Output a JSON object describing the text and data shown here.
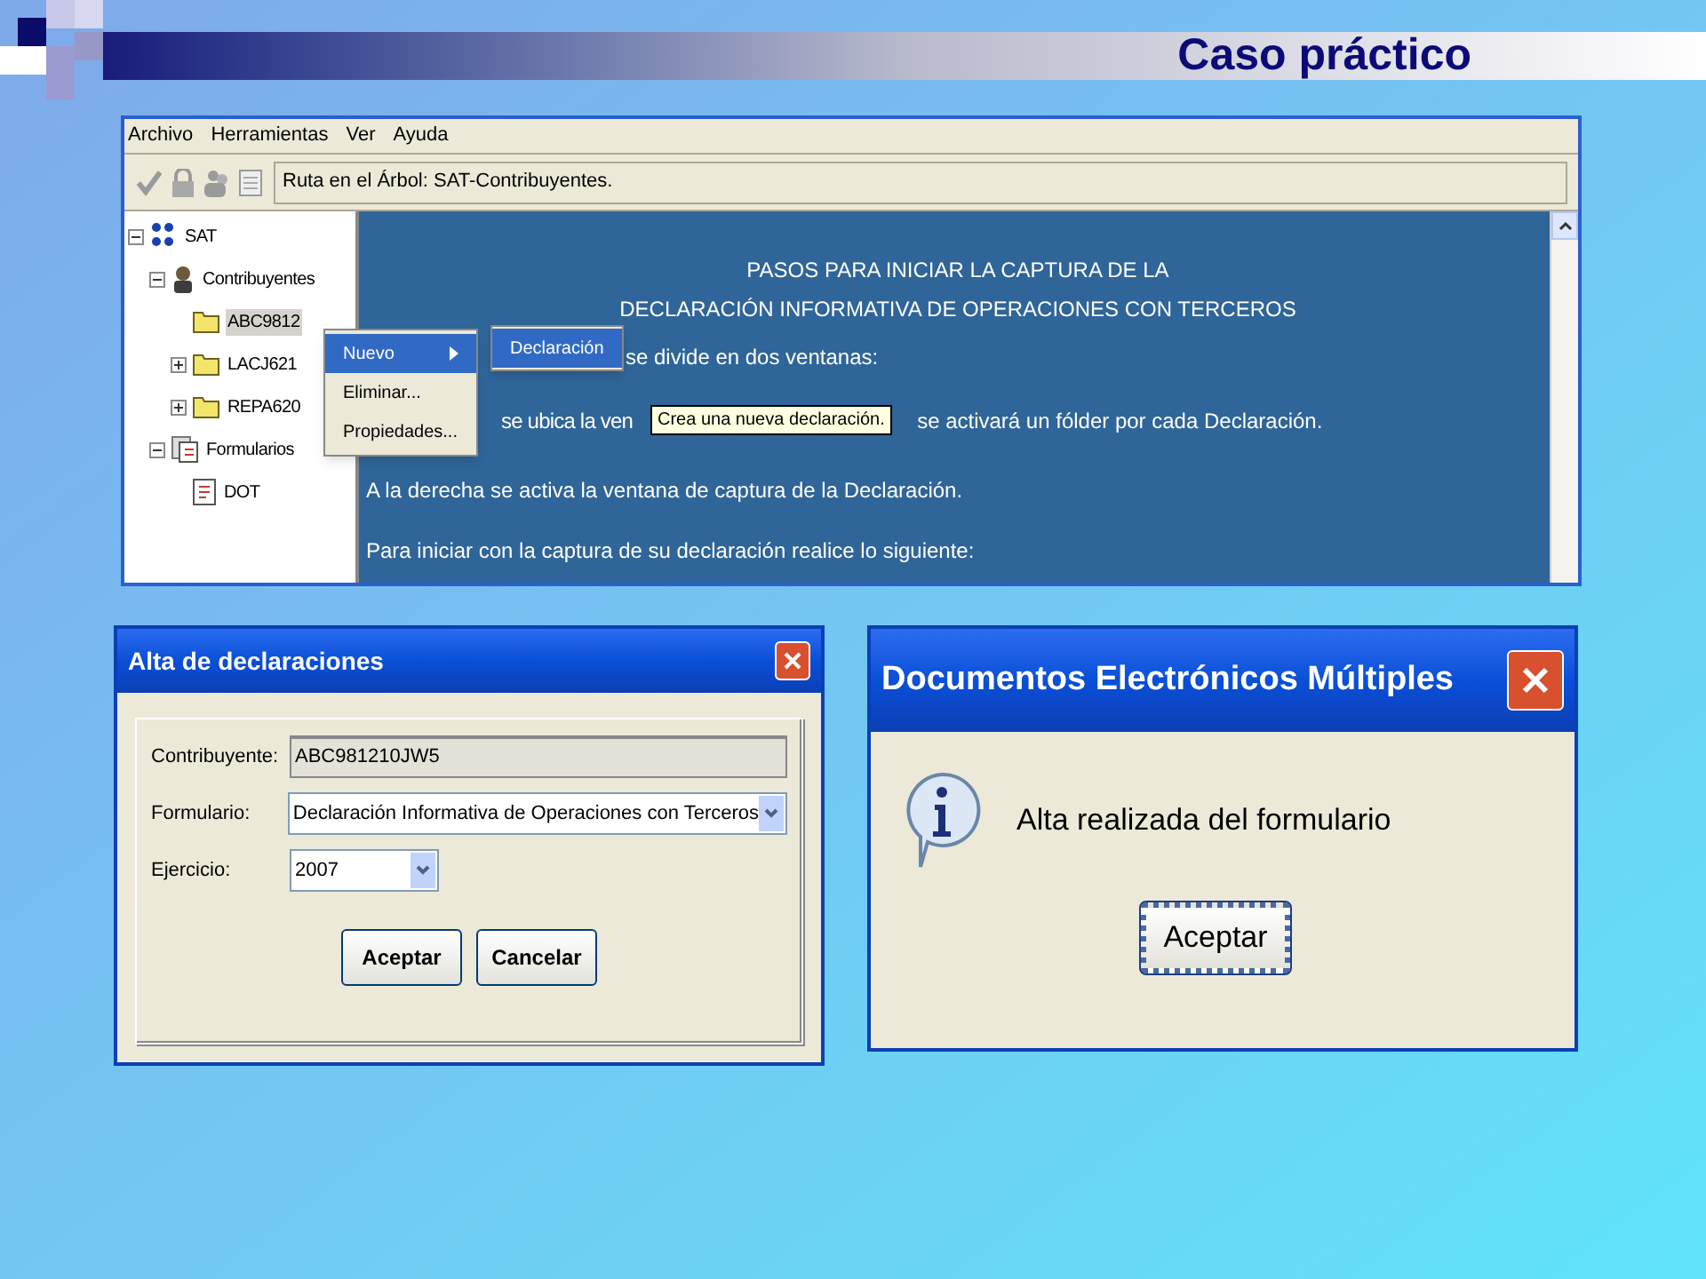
{
  "slide_title": "Caso práctico",
  "main_window": {
    "menu": [
      "Archivo",
      "Herramientas",
      "Ver",
      "Ayuda"
    ],
    "path_field": "Ruta en el Árbol: SAT-Contribuyentes.",
    "tree": [
      {
        "label": "SAT",
        "kind": "root",
        "expanded": true,
        "selected": false,
        "children": [
          {
            "label": "Contribuyentes",
            "kind": "person",
            "expanded": true,
            "selected": false,
            "children": [
              {
                "label": "ABC9812",
                "kind": "folder",
                "selected": true
              },
              {
                "label": "LACJ621",
                "kind": "folder",
                "expanded": false,
                "selected": false
              },
              {
                "label": "REPA620",
                "kind": "folder",
                "expanded": false,
                "selected": false
              }
            ]
          },
          {
            "label": "Formularios",
            "kind": "forms",
            "expanded": true,
            "selected": false,
            "children": [
              {
                "label": "DOT",
                "kind": "form",
                "selected": false
              }
            ]
          }
        ]
      }
    ],
    "heading": [
      "PASOS PARA INICIAR LA CAPTURA DE LA",
      "DECLARACIÓN INFORMATIVA DE OPERACIONES CON TERCEROS"
    ],
    "line_1": "se divide en dos ventanas:",
    "line_2_start": "se ubica la ven",
    "line_2_end": "se activará un fólder por cada Declaración.",
    "line_3": "A la derecha se activa la ventana de captura de la Declaración.",
    "line_4": "Para iniciar con la captura de su declaración realice lo siguiente:",
    "context_menu": [
      {
        "label": "Nuevo",
        "selected": true,
        "submenu": true
      },
      {
        "label": "Eliminar...",
        "selected": false,
        "submenu": false
      },
      {
        "label": "Propiedades...",
        "selected": false,
        "submenu": false
      }
    ],
    "submenu": [
      {
        "label": "Declaración",
        "selected": true
      }
    ],
    "tooltip": "Crea una nueva declaración."
  },
  "dialog_1": {
    "title": "Alta de declaraciones",
    "fields": [
      {
        "label": "Contribuyente:",
        "value": "ABC981210JW5",
        "kind": "readonly"
      },
      {
        "label": "Formulario:",
        "value": "Declaración Informativa de Operaciones con Terceros",
        "kind": "select"
      },
      {
        "label": "Ejercicio:",
        "value": "2007",
        "kind": "select"
      }
    ],
    "buttons": [
      "Aceptar",
      "Cancelar"
    ]
  },
  "dialog_2": {
    "title": "Documentos Electrónicos Múltiples",
    "message": "Alta realizada del formulario",
    "button": "Aceptar",
    "focused": true
  }
}
